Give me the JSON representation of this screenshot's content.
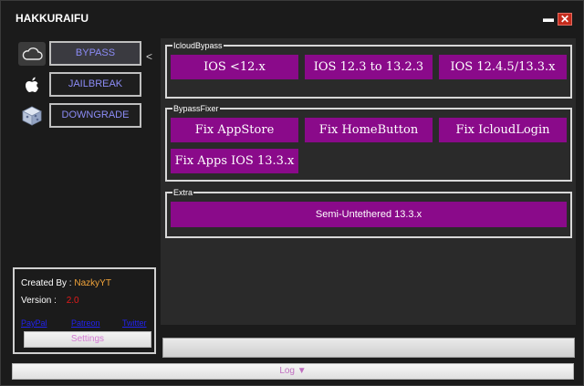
{
  "window": {
    "title": "HAKKURAIFU",
    "minimize_glyph": "▬",
    "close_glyph": "✕",
    "colors": {
      "background": "#1b1b1b",
      "accent": "#8a0a8a",
      "close": "#c42b1c"
    }
  },
  "sidebar": {
    "collapse_glyph": "<",
    "items": [
      {
        "label": "BYPASS",
        "icon": "cloud-icon"
      },
      {
        "label": "JAILBREAK",
        "icon": "apple-icon"
      },
      {
        "label": "DOWNGRADE",
        "icon": "cube-icon"
      }
    ]
  },
  "info": {
    "created_by_label": "Created By :",
    "created_by_value": "NazkyYT",
    "version_label": "Version :",
    "version_value": "2.0",
    "links": [
      "PayPal",
      "Patreon",
      "Twitter"
    ],
    "settings_label": "Settings"
  },
  "groups": {
    "icloud_bypass": {
      "title": "IcloudBypass",
      "buttons": [
        "IOS <12.x",
        "IOS 12.3 to 13.2.3",
        "IOS 12.4.5/13.3.x"
      ]
    },
    "bypass_fixer": {
      "title": "BypassFixer",
      "buttons": [
        "Fix AppStore",
        "Fix HomeButton",
        "Fix IcloudLogin",
        "Fix Apps IOS 13.3.x"
      ]
    },
    "extra": {
      "title": "Extra",
      "buttons": [
        "Semi-Untethered 13.3.x"
      ]
    }
  },
  "progress": {
    "value": 0
  },
  "log": {
    "label": "Log ▼"
  }
}
